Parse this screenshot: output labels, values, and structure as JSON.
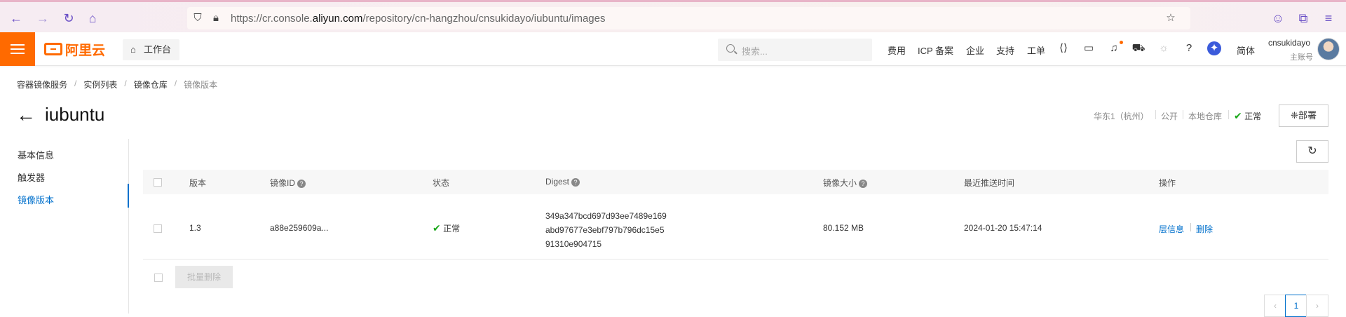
{
  "browser": {
    "url_prefix": "https://cr.console.",
    "url_domain": "aliyun.com",
    "url_path": "/repository/cn-hangzhou/cnsukidayo/iubuntu/images"
  },
  "header": {
    "logo_text": "阿里云",
    "workbench": "工作台",
    "search_placeholder": "搜索...",
    "nav": [
      "费用",
      "ICP 备案",
      "企业",
      "支持",
      "工单"
    ],
    "language": "简体",
    "user_name": "cnsukidayo",
    "user_role": "主账号"
  },
  "breadcrumb": [
    "容器镜像服务",
    "实例列表",
    "镜像仓库",
    "镜像版本"
  ],
  "page": {
    "title": "iubuntu",
    "region": "华东1（杭州）",
    "visibility": "公开",
    "repo_type": "本地仓库",
    "status": "正常",
    "deploy_label": "部署"
  },
  "sidebar": {
    "items": [
      {
        "label": "基本信息"
      },
      {
        "label": "触发器"
      },
      {
        "label": "镜像版本"
      }
    ]
  },
  "table": {
    "columns": [
      "版本",
      "镜像ID",
      "状态",
      "Digest",
      "镜像大小",
      "最近推送时间",
      "操作"
    ],
    "rows": [
      {
        "version": "1.3",
        "image_id": "a88e259609a...",
        "status": "正常",
        "digest": [
          "349a347bcd697d93ee7489e169",
          "abd97677e3ebf797b796dc15e5",
          "91310e904715"
        ],
        "size": "80.152 MB",
        "pushed": "2024-01-20 15:47:14",
        "op_layers": "层信息",
        "op_delete": "删除"
      }
    ],
    "batch_delete": "批量删除"
  },
  "pagination": {
    "current": "1"
  }
}
